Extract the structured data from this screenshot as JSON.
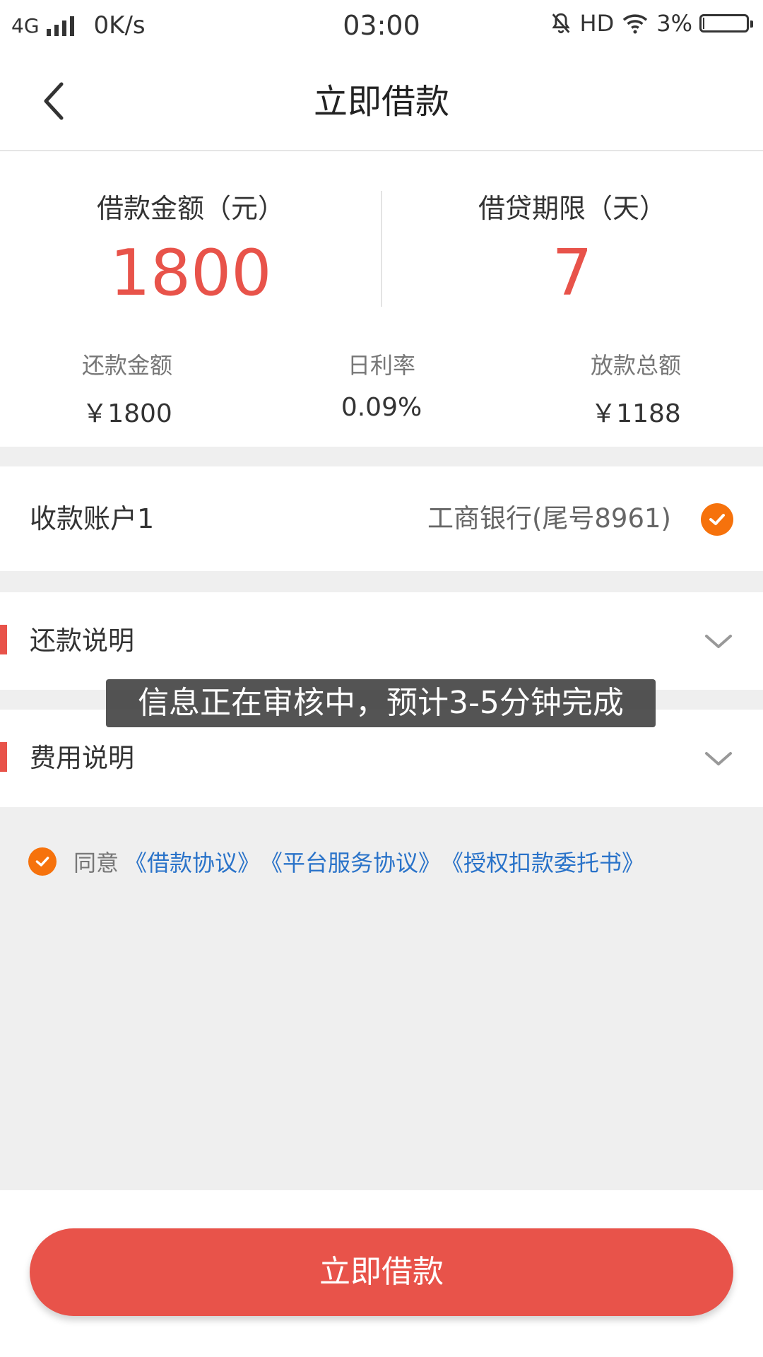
{
  "status_bar": {
    "network": "4G",
    "speed": "0K/s",
    "time": "03:00",
    "hd": "HD",
    "battery": "3%",
    "battery_level": 0.03
  },
  "header": {
    "title": "立即借款"
  },
  "summary": {
    "amount_label": "借款金额（元）",
    "amount_value": "1800",
    "term_label": "借贷期限（天）",
    "term_value": "7",
    "stats": [
      {
        "label": "还款金额",
        "value": "￥1800"
      },
      {
        "label": "日利率",
        "value": "0.09%"
      },
      {
        "label": "放款总额",
        "value": "￥1188"
      }
    ]
  },
  "account": {
    "label": "收款账户1",
    "value": "工商银行(尾号8961)"
  },
  "sections": {
    "repayment": "还款说明",
    "fees": "费用说明"
  },
  "agreement": {
    "prefix": "同意",
    "links": [
      "《借款协议》",
      "《平台服务协议》",
      "《授权扣款委托书》"
    ]
  },
  "toast": "信息正在审核中，预计3-5分钟完成",
  "submit_label": "立即借款",
  "colors": {
    "accent": "#e8534a",
    "check": "#f6720c",
    "link": "#2a73c9"
  }
}
